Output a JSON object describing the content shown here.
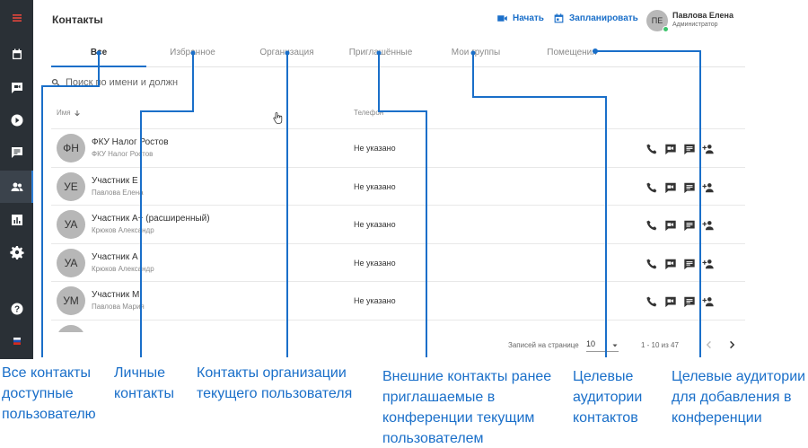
{
  "sidebar": {
    "items": [
      {
        "icon": "menu-icon",
        "active": false
      },
      {
        "icon": "calendar-icon",
        "active": false
      },
      {
        "icon": "chat-video-icon",
        "active": false
      },
      {
        "icon": "play-icon",
        "active": false
      },
      {
        "icon": "message-icon",
        "active": false
      },
      {
        "icon": "contacts-icon",
        "active": true
      },
      {
        "icon": "chart-icon",
        "active": false
      },
      {
        "icon": "gear-icon",
        "active": false
      },
      {
        "icon": "help-icon",
        "active": false
      },
      {
        "icon": "flag-ru-icon",
        "active": false
      }
    ],
    "accent": "#2f7fd6",
    "menu_color": "#e5463c"
  },
  "header": {
    "title": "Контакты",
    "start_label": "Начать",
    "schedule_label": "Запланировать",
    "user": {
      "initials": "ПЕ",
      "name": "Павлова Елена",
      "role": "Администратор"
    }
  },
  "tabs": [
    {
      "label": "Все",
      "active": true
    },
    {
      "label": "Избранное",
      "active": false
    },
    {
      "label": "Организация",
      "active": false
    },
    {
      "label": "Приглашённые",
      "active": false
    },
    {
      "label": "Мои группы",
      "active": false
    },
    {
      "label": "Помещения",
      "active": false
    }
  ],
  "search": {
    "placeholder": "Поиск по имени и должн"
  },
  "table": {
    "columns": {
      "name": "Имя",
      "phone": "Телефон"
    },
    "rows": [
      {
        "initials": "ФН",
        "name": "ФКУ Налог Ростов",
        "sub": "ФКУ Налог Ростов",
        "phone": "Не указано"
      },
      {
        "initials": "УЕ",
        "name": "Участник Е",
        "sub": "Павлова Елена",
        "phone": "Не указано"
      },
      {
        "initials": "УА",
        "name": "Участник А+ (расширенный)",
        "sub": "Крюков Александр",
        "phone": "Не указано"
      },
      {
        "initials": "УА",
        "name": "Участник А",
        "sub": "Крюков Александр",
        "phone": "Не указано"
      },
      {
        "initials": "УМ",
        "name": "Участник М",
        "sub": "Павлова Мария",
        "phone": "Не указано"
      }
    ],
    "row_actions": [
      "phone-icon",
      "video-call-icon",
      "chat-icon",
      "add-person-icon"
    ]
  },
  "pager": {
    "label": "Записей на странице",
    "per_page": "10",
    "range": "1 - 10 из 47"
  },
  "annotations": [
    {
      "text": "Все контакты доступные пользователю"
    },
    {
      "text": "Личные контакты"
    },
    {
      "text": "Контакты организации текущего пользователя"
    },
    {
      "text": "Внешние контакты ранее приглашаемые в конференции текущим пользователем"
    },
    {
      "text": "Целевые аудитории контактов"
    },
    {
      "text": "Целевые аудитории для добавления в конференции"
    }
  ],
  "colors": {
    "accent": "#1a6fc9",
    "sidebar": "#2a3036",
    "online": "#3cc46c"
  }
}
